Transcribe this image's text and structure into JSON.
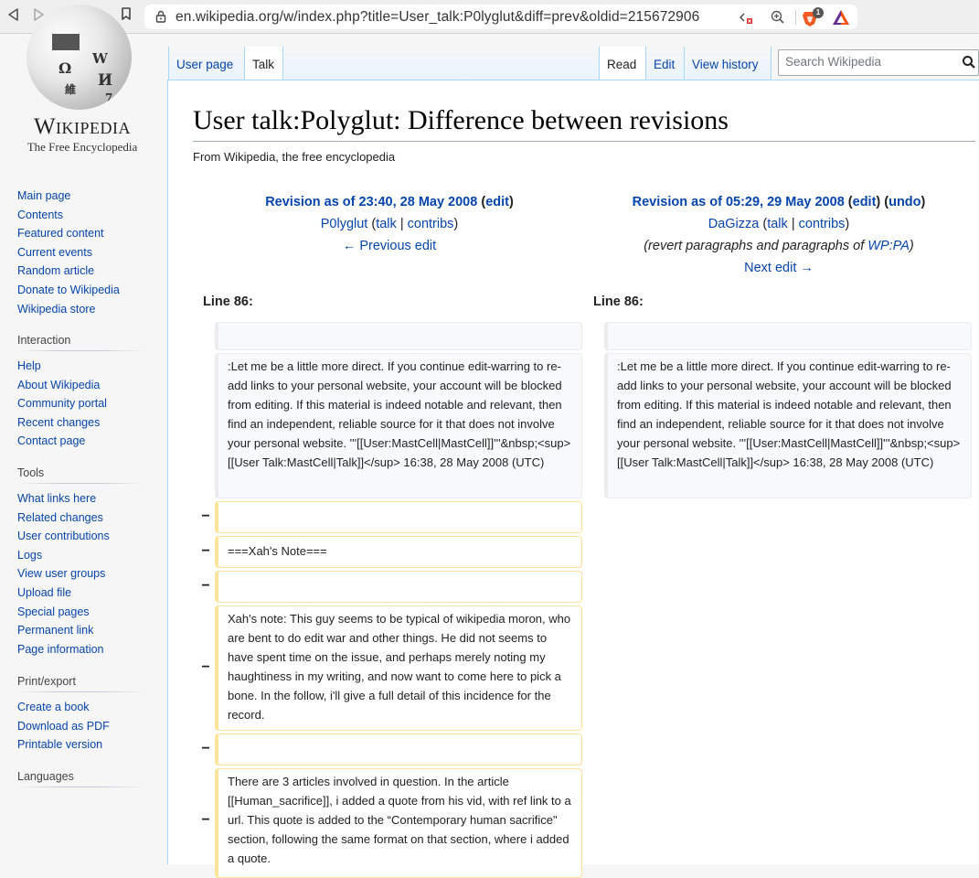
{
  "browser": {
    "url": "en.wikipedia.org/w/index.php?title=User_talk:P0lyglut&diff=prev&oldid=215672906",
    "brave_badge_count": "1",
    "icons": [
      "back-icon",
      "forward-icon",
      "reload-icon",
      "bookmark-icon",
      "lock-icon",
      "code-blocked-icon",
      "zoom-icon",
      "brave-shield-icon",
      "bat-rewards-icon"
    ]
  },
  "logo": {
    "wordmark": "Wikipedia",
    "tagline": "The Free Encyclopedia"
  },
  "sidebar": {
    "navigation": [
      "Main page",
      "Contents",
      "Featured content",
      "Current events",
      "Random article",
      "Donate to Wikipedia",
      "Wikipedia store"
    ],
    "interaction": {
      "heading": "Interaction",
      "items": [
        "Help",
        "About Wikipedia",
        "Community portal",
        "Recent changes",
        "Contact page"
      ]
    },
    "tools": {
      "heading": "Tools",
      "items": [
        "What links here",
        "Related changes",
        "User contributions",
        "Logs",
        "View user groups",
        "Upload file",
        "Special pages",
        "Permanent link",
        "Page information"
      ]
    },
    "print": {
      "heading": "Print/export",
      "items": [
        "Create a book",
        "Download as PDF",
        "Printable version"
      ]
    },
    "languages": {
      "heading": "Languages"
    }
  },
  "tabs": {
    "user_page": "User page",
    "talk": "Talk",
    "read": "Read",
    "edit": "Edit",
    "history": "View history"
  },
  "search": {
    "placeholder": "Search Wikipedia"
  },
  "page": {
    "title": "User talk:Polyglut: Difference between revisions",
    "site_tagline": "From Wikipedia, the free encyclopedia"
  },
  "diff": {
    "left": {
      "revision": "Revision as of 23:40, 28 May 2008",
      "edit": "edit",
      "user": "P0lyglut",
      "talk": "talk",
      "sep": "|",
      "contribs": "contribs",
      "nav": "← Previous edit",
      "line": "Line 86:"
    },
    "right": {
      "revision": "Revision as of 05:29, 29 May 2008",
      "edit": "edit",
      "undo": "undo",
      "user": "DaGizza",
      "talk": "talk",
      "sep": "|",
      "contribs": "contribs",
      "summary_prefix": "(revert paragraphs and paragraphs of ",
      "summary_link": "WP:PA",
      "summary_suffix": ")",
      "nav": "Next edit →",
      "line": "Line 86:"
    },
    "context_text": ":Let me be a little more direct. If you continue edit-warring to re-add links to your personal website, your account will be blocked from editing. If this material is indeed notable and relevant, then find an independent, reliable source for it that does not involve your personal website. '''[[User:MastCell|MastCell]]'''&nbsp;<sup>[[User Talk:MastCell|Talk]]</sup> 16:38, 28 May 2008 (UTC)",
    "deleted_marker": "−",
    "deleted_lines": [
      "",
      "===Xah's Note===",
      "",
      "Xah's note: This guy seems to be typical of wikipedia moron, who are bent to do edit war and other things. He did not seems to have spent time on the issue, and perhaps merely noting my haughtiness in my writing, and now want to come here to pick a bone. In the follow, i'll give a full detail of this incidence for the record.",
      "",
      "There are 3 articles involved in question. In the article [[Human_sacrifice]], i added a quote from his vid, with ref link to a url. This quote is added to the “Contemporary human sacrifice\" section, following the same format on that section, where i added a quote."
    ]
  }
}
